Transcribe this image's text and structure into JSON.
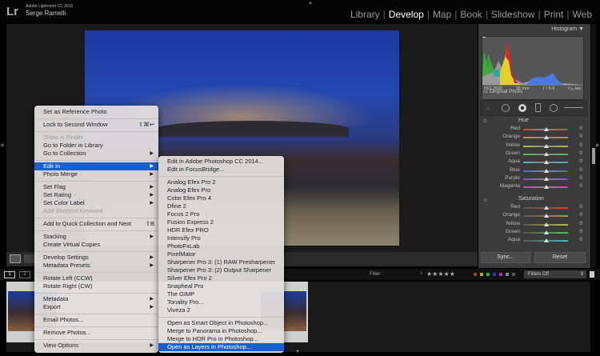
{
  "app": {
    "logo": "Lr",
    "name": "Adobe Lightroom CC 2015",
    "user": "Serge Ramelli"
  },
  "modules": [
    {
      "label": "Library",
      "active": false
    },
    {
      "label": "Develop",
      "active": true
    },
    {
      "label": "Map",
      "active": false
    },
    {
      "label": "Book",
      "active": false
    },
    {
      "label": "Slideshow",
      "active": false
    },
    {
      "label": "Print",
      "active": false
    },
    {
      "label": "Web",
      "active": false
    }
  ],
  "histogram": {
    "title": "Histogram",
    "iso": "ISO 2500",
    "focal": "35 mm",
    "aperture": "ƒ / 5.6",
    "shutter": "¹⁄₂₅ sec",
    "original": "Original Photo"
  },
  "hsl": {
    "hue_title": "Hue",
    "sat_title": "Saturation",
    "hue": [
      {
        "label": "Red",
        "value": "0",
        "color": "#c44"
      },
      {
        "label": "Orange",
        "value": "0",
        "color": "#c84"
      },
      {
        "label": "Yellow",
        "value": "0",
        "color": "#bb4"
      },
      {
        "label": "Green",
        "value": "0",
        "color": "#5b5"
      },
      {
        "label": "Aqua",
        "value": "0",
        "color": "#4bb"
      },
      {
        "label": "Blue",
        "value": "0",
        "color": "#46c"
      },
      {
        "label": "Purple",
        "value": "0",
        "color": "#84c"
      },
      {
        "label": "Magenta",
        "value": "0",
        "color": "#c4a"
      }
    ],
    "sat": [
      {
        "label": "Red",
        "value": "0",
        "color": "#c44"
      },
      {
        "label": "Orange",
        "value": "0",
        "color": "#c84"
      },
      {
        "label": "Yellow",
        "value": "0",
        "color": "#bb4"
      },
      {
        "label": "Green",
        "value": "0",
        "color": "#5b5"
      },
      {
        "label": "Aqua",
        "value": "0",
        "color": "#4bb"
      }
    ]
  },
  "panel_buttons": {
    "sync": "Sync...",
    "reset": "Reset"
  },
  "filter": {
    "label": "Filter :",
    "rating_op": "≥",
    "stars": "★★★★★",
    "preset": "Filters Off"
  },
  "filmstrip": {
    "pages": [
      "1",
      "2"
    ]
  },
  "context_menu": [
    {
      "label": "Set as Reference Photo"
    },
    {
      "sep": true
    },
    {
      "label": "Lock to Second Window",
      "shortcut": "⇧⌘↩"
    },
    {
      "sep": true
    },
    {
      "label": "Show in Finder",
      "disabled": true
    },
    {
      "label": "Go to Folder in Library"
    },
    {
      "label": "Go to Collection",
      "arrow": true
    },
    {
      "sep": true
    },
    {
      "label": "Edit In",
      "arrow": true,
      "highlighted": true
    },
    {
      "label": "Photo Merge",
      "arrow": true
    },
    {
      "sep": true
    },
    {
      "label": "Set Flag",
      "arrow": true
    },
    {
      "label": "Set Rating",
      "arrow": true
    },
    {
      "label": "Set Color Label",
      "arrow": true
    },
    {
      "label": "Add Shortcut Keyword",
      "disabled": true
    },
    {
      "sep": true
    },
    {
      "label": "Add to Quick Collection and Next",
      "shortcut": "⇧B"
    },
    {
      "sep": true
    },
    {
      "label": "Stacking",
      "arrow": true
    },
    {
      "label": "Create Virtual Copies"
    },
    {
      "sep": true
    },
    {
      "label": "Develop Settings",
      "arrow": true
    },
    {
      "label": "Metadata Presets",
      "arrow": true
    },
    {
      "sep": true
    },
    {
      "label": "Rotate Left (CCW)"
    },
    {
      "label": "Rotate Right (CW)"
    },
    {
      "sep": true
    },
    {
      "label": "Metadata",
      "arrow": true
    },
    {
      "label": "Export",
      "arrow": true
    },
    {
      "sep": true
    },
    {
      "label": "Email Photos..."
    },
    {
      "sep": true
    },
    {
      "label": "Remove Photos..."
    },
    {
      "sep": true
    },
    {
      "label": "View Options",
      "arrow": true
    }
  ],
  "edit_in_submenu": [
    {
      "label": "Edit in Adobe Photoshop CC 2014..."
    },
    {
      "label": "Edit in FocusBridge..."
    },
    {
      "sep": true
    },
    {
      "label": "Analog Efex Pro 2"
    },
    {
      "label": "Analog Efex Pro"
    },
    {
      "label": "Color Efex Pro 4"
    },
    {
      "label": "Dfine 2"
    },
    {
      "label": "Focus 2 Pro"
    },
    {
      "label": "Fusion Express 2"
    },
    {
      "label": "HDR Efex PRO"
    },
    {
      "label": "Intensify Pro"
    },
    {
      "label": "PhotoFxLab"
    },
    {
      "label": "PixelMator"
    },
    {
      "label": "Sharpener Pro 3: (1) RAW Presharpener"
    },
    {
      "label": "Sharpener Pro 3: (2) Output Sharpener"
    },
    {
      "label": "Silver Efex Pro 2"
    },
    {
      "label": "Snapheal Pro"
    },
    {
      "label": "The GIMP"
    },
    {
      "label": "Tonality Pro..."
    },
    {
      "label": "Viveza 2"
    },
    {
      "sep": true
    },
    {
      "label": "Open as Smart Object in Photoshop..."
    },
    {
      "label": "Merge to Panorama in Photoshop..."
    },
    {
      "label": "Merge to HDR Pro in Photoshop..."
    },
    {
      "label": "Open as Layers in Photoshop...",
      "highlighted": true
    }
  ]
}
